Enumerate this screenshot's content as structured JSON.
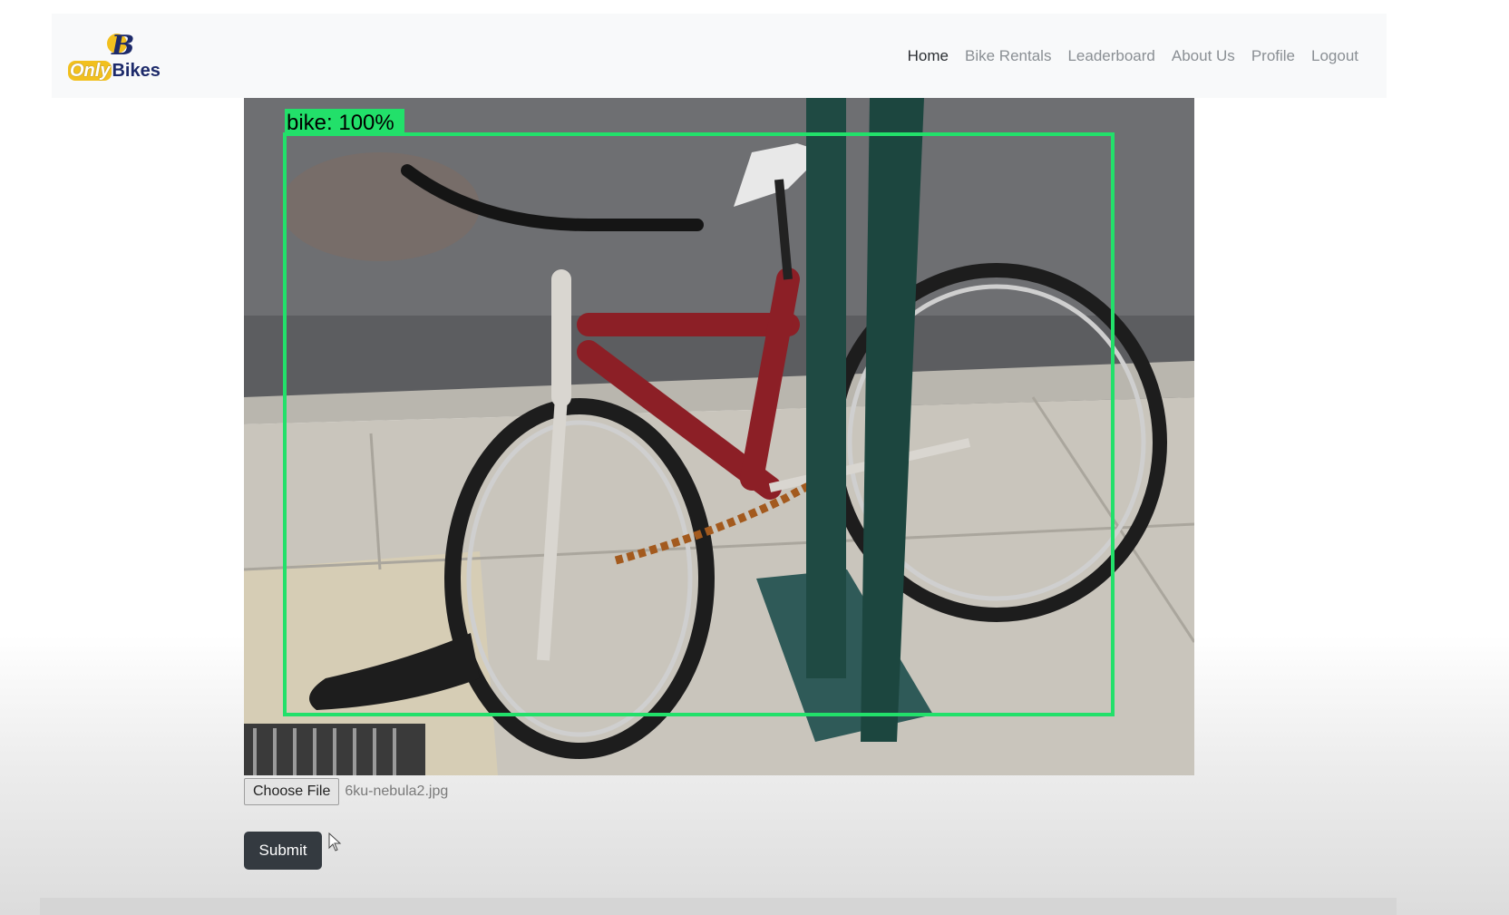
{
  "brand": {
    "logo_letter": "B",
    "word_only": "Only",
    "word_bikes": "Bikes"
  },
  "nav": [
    {
      "label": "Home",
      "active": true
    },
    {
      "label": "Bike Rentals",
      "active": false
    },
    {
      "label": "Leaderboard",
      "active": false
    },
    {
      "label": "About Us",
      "active": false
    },
    {
      "label": "Profile",
      "active": false
    },
    {
      "label": "Logout",
      "active": false
    }
  ],
  "detection": {
    "label": "bike: 100%",
    "box_color": "#22e06a"
  },
  "upload": {
    "button_label": "Choose File",
    "file_name": "6ku-nebula2.jpg"
  },
  "submit": {
    "label": "Submit"
  },
  "colors": {
    "brand_yellow": "#f2c01e",
    "brand_navy": "#1d2a6a",
    "dark_button": "#343a40"
  }
}
